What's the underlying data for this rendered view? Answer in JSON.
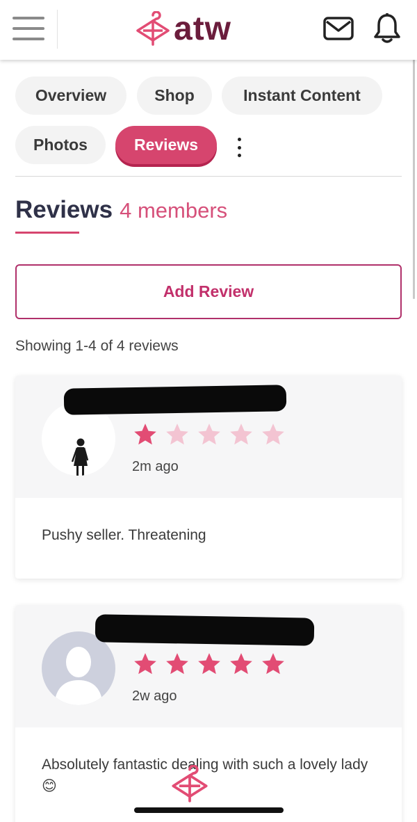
{
  "header": {
    "brand": "atw",
    "icons": [
      "menu-icon",
      "hanger-logo-icon",
      "mail-icon",
      "bell-icon"
    ]
  },
  "tabs": [
    {
      "label": "Overview",
      "active": false
    },
    {
      "label": "Shop",
      "active": false
    },
    {
      "label": "Instant Content",
      "active": false
    },
    {
      "label": "Photos",
      "active": false
    },
    {
      "label": "Reviews",
      "active": true
    }
  ],
  "section": {
    "title": "Reviews",
    "count": "4 members"
  },
  "add_review_label": "Add Review",
  "showing_text": "Showing 1-4 of 4 reviews",
  "reviews": [
    {
      "rating": 1,
      "time": "2m ago",
      "text": "Pushy seller. Threatening",
      "avatar": "female-silhouette"
    },
    {
      "rating": 5,
      "time": "2w ago",
      "text": "Absolutely fantastic dealing with such a lovely lady 😊",
      "avatar": "default-user"
    }
  ],
  "colors": {
    "accent": "#d6456e",
    "brand": "#6b1d3c",
    "star_filled": "#e24c74",
    "star_empty": "#f3c4d2"
  }
}
